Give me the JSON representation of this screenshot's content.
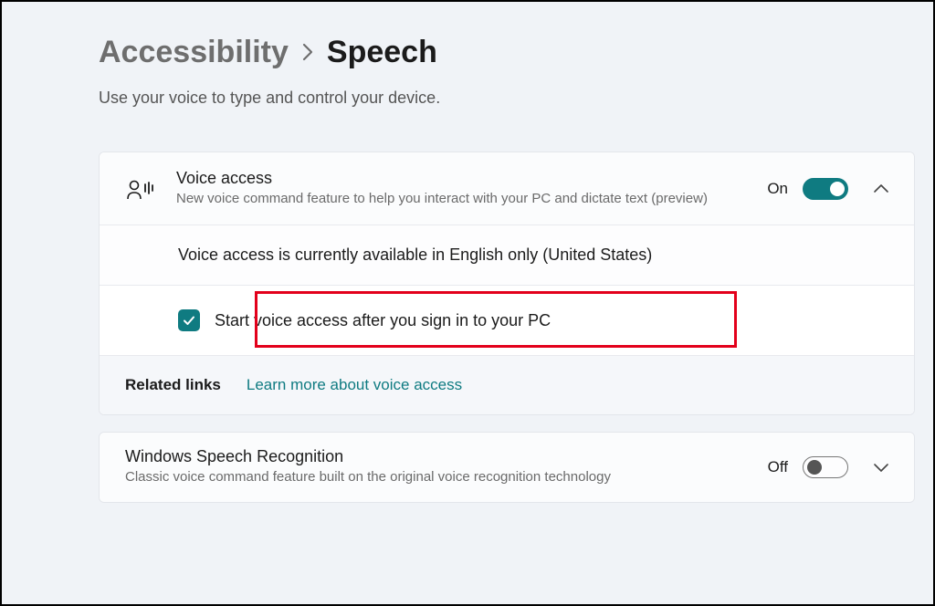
{
  "breadcrumb": {
    "parent": "Accessibility",
    "current": "Speech"
  },
  "subtitle": "Use your voice to type and control your device.",
  "voiceAccess": {
    "title": "Voice access",
    "desc": "New voice command feature to help you interact with your PC and dictate text (preview)",
    "toggleState": "On",
    "availabilityNote": "Voice access is currently available in English only (United States)",
    "startAfterSignInLabel": "Start voice access after you sign in to your PC",
    "relatedLabel": "Related links",
    "learnMoreLabel": "Learn more about voice access"
  },
  "speechRecognition": {
    "title": "Windows Speech Recognition",
    "desc": "Classic voice command feature built on the original voice recognition technology",
    "toggleState": "Off"
  }
}
